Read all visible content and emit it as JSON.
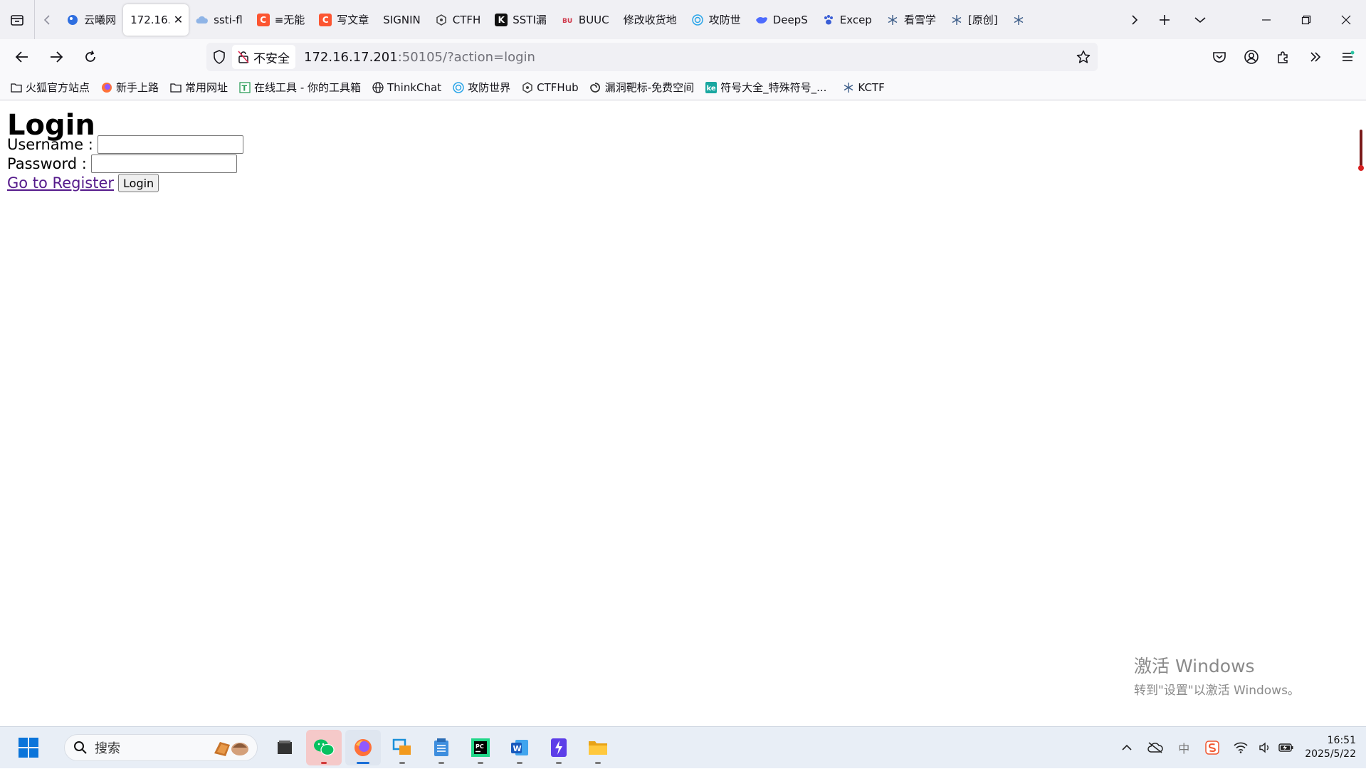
{
  "browser": {
    "tabs": [
      {
        "title": "云曦网",
        "favicon": "blue-globe",
        "color": "#2f6fe0",
        "active": false
      },
      {
        "title": "172.16.",
        "favicon": "none",
        "color": "",
        "active": true
      },
      {
        "title": "ssti-fl",
        "favicon": "cloud",
        "color": "#5b8fd6",
        "active": false
      },
      {
        "title": "≡无能",
        "favicon": "C",
        "color": "#fc5531",
        "active": false
      },
      {
        "title": "写文章",
        "favicon": "C",
        "color": "#fc5531",
        "active": false
      },
      {
        "title": "SIGNIN",
        "favicon": "none",
        "color": "",
        "active": false
      },
      {
        "title": "CTFH",
        "favicon": "hex",
        "color": "#444444",
        "active": false
      },
      {
        "title": "SSTI漏",
        "favicon": "K",
        "color": "#111111",
        "active": false
      },
      {
        "title": "BUUC",
        "favicon": "buu",
        "color": "#d0394b",
        "active": false
      },
      {
        "title": "修改收货地",
        "favicon": "none",
        "color": "",
        "active": false
      },
      {
        "title": "攻防世",
        "favicon": "target",
        "color": "#2aa5e8",
        "active": false
      },
      {
        "title": "DeepS",
        "favicon": "whale",
        "color": "#4d6bfe",
        "active": false
      },
      {
        "title": "Excep",
        "favicon": "paw",
        "color": "#3a5ed6",
        "active": false
      },
      {
        "title": "看雪学",
        "favicon": "snowflake",
        "color": "#3f5f8a",
        "active": false
      },
      {
        "title": "[原创]",
        "favicon": "snowflake",
        "color": "#3f5f8a",
        "active": false
      },
      {
        "title": "",
        "favicon": "snowflake",
        "color": "#3f5f8a",
        "active": false
      }
    ],
    "nav": {
      "security_label": "不安全",
      "url_host": "172.16.17.201",
      "url_rest": ":50105/?action=login"
    },
    "bookmarks": [
      {
        "label": "火狐官方站点",
        "icon": "folder-icon"
      },
      {
        "label": "新手上路",
        "icon": "firefox-icon"
      },
      {
        "label": "常用网址",
        "icon": "folder-icon"
      },
      {
        "label": "在线工具 - 你的工具箱",
        "icon": "tool-icon"
      },
      {
        "label": "ThinkChat",
        "icon": "globe-icon"
      },
      {
        "label": "攻防世界",
        "icon": "target-icon"
      },
      {
        "label": "CTFHub",
        "icon": "hex-icon"
      },
      {
        "label": "漏洞靶标-免费空间",
        "icon": "swirl-icon"
      },
      {
        "label": "符号大全_特殊符号_...",
        "icon": "ke-icon"
      },
      {
        "label": "KCTF",
        "icon": "snowflake-icon"
      }
    ]
  },
  "page": {
    "heading": "Login",
    "username_label": "Username :",
    "username_value": "",
    "password_label": "Password :",
    "password_value": "",
    "register_link": "Go to Register",
    "login_button": "Login"
  },
  "watermark": {
    "line1": "激活 Windows",
    "line2": "转到\"设置\"以激活 Windows。"
  },
  "taskbar": {
    "search_placeholder": "搜索",
    "apps": [
      "file-viewer",
      "wechat",
      "firefox",
      "remote-desktop",
      "notepad",
      "pycharm",
      "word",
      "terminal",
      "file-explorer"
    ],
    "time": "16:51",
    "date": "2025/5/22",
    "ime_label": "中"
  }
}
